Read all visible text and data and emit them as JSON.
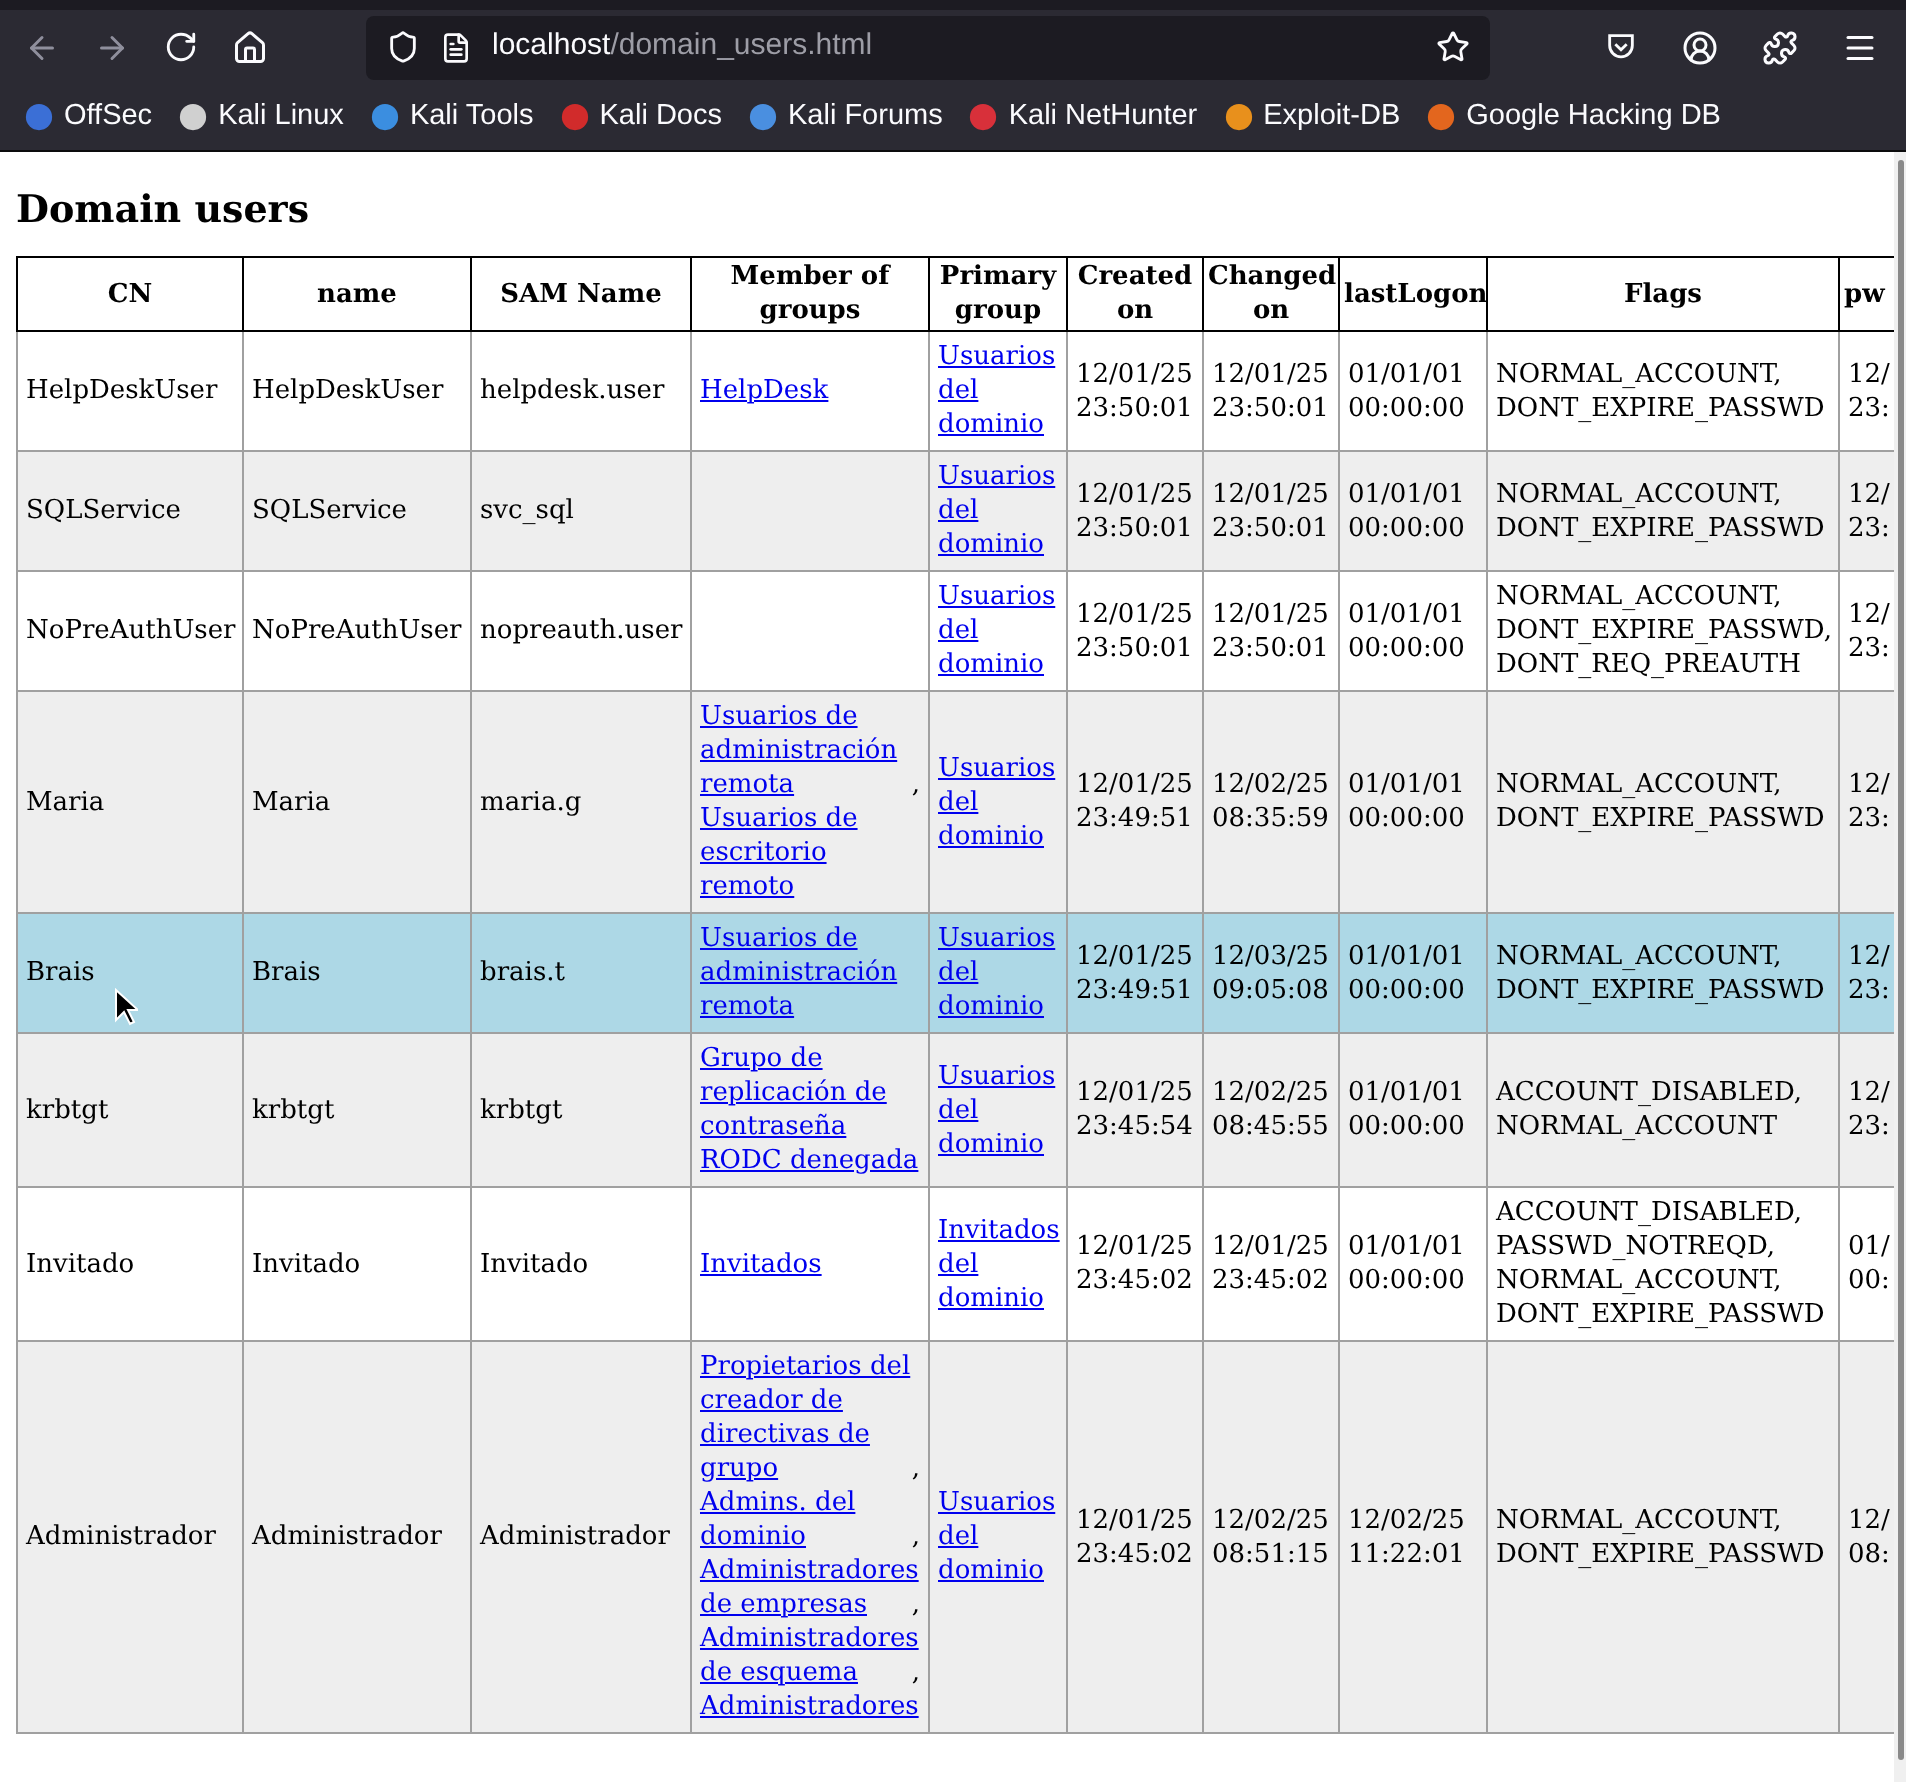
{
  "browser": {
    "url": {
      "host": "localhost",
      "path": "/domain_users.html"
    },
    "bookmarks": [
      {
        "label": "OffSec",
        "color": "#3b6fd6"
      },
      {
        "label": "Kali Linux",
        "color": "#d0d0d0"
      },
      {
        "label": "Kali Tools",
        "color": "#3b8ee0"
      },
      {
        "label": "Kali Docs",
        "color": "#d12b2b"
      },
      {
        "label": "Kali Forums",
        "color": "#4a8fe0"
      },
      {
        "label": "Kali NetHunter",
        "color": "#d8303a"
      },
      {
        "label": "Exploit-DB",
        "color": "#e8901c"
      },
      {
        "label": "Google Hacking DB",
        "color": "#e3661e"
      }
    ]
  },
  "page": {
    "heading": "Domain users",
    "table": {
      "columns": [
        "CN",
        "name",
        "SAM Name",
        "Member of groups",
        "Primary group",
        "Created on",
        "Changed on",
        "lastLogon",
        "Flags",
        "pw"
      ],
      "rows": [
        {
          "selected": false,
          "cn": "HelpDeskUser",
          "name": "HelpDeskUser",
          "sam": "helpdesk.user",
          "member_of": [
            {
              "label": "HelpDesk"
            }
          ],
          "primary_group": "Usuarios del dominio",
          "created": "12/01/25 23:50:01",
          "changed": "12/01/25 23:50:01",
          "last_logon": "01/01/01 00:00:00",
          "flags": "NORMAL_ACCOUNT, DONT_EXPIRE_PASSWD",
          "pwd": "12/ 23:"
        },
        {
          "selected": false,
          "cn": "SQLService",
          "name": "SQLService",
          "sam": "svc_sql",
          "member_of": [],
          "primary_group": "Usuarios del dominio",
          "created": "12/01/25 23:50:01",
          "changed": "12/01/25 23:50:01",
          "last_logon": "01/01/01 00:00:00",
          "flags": "NORMAL_ACCOUNT, DONT_EXPIRE_PASSWD",
          "pwd": "12/ 23:"
        },
        {
          "selected": false,
          "cn": "NoPreAuthUser",
          "name": "NoPreAuthUser",
          "sam": "nopreauth.user",
          "member_of": [],
          "primary_group": "Usuarios del dominio",
          "created": "12/01/25 23:50:01",
          "changed": "12/01/25 23:50:01",
          "last_logon": "01/01/01 00:00:00",
          "flags": "NORMAL_ACCOUNT, DONT_EXPIRE_PASSWD, DONT_REQ_PREAUTH",
          "pwd": "12/ 23:"
        },
        {
          "selected": false,
          "cn": "Maria",
          "name": "Maria",
          "sam": "maria.g",
          "member_of": [
            {
              "label": "Usuarios de administración remota",
              "suffix": ","
            },
            {
              "label": "Usuarios de escritorio remoto"
            }
          ],
          "primary_group": "Usuarios del dominio",
          "created": "12/01/25 23:49:51",
          "changed": "12/02/25 08:35:59",
          "last_logon": "01/01/01 00:00:00",
          "flags": "NORMAL_ACCOUNT, DONT_EXPIRE_PASSWD",
          "pwd": "12/ 23:"
        },
        {
          "selected": true,
          "cn": "Brais",
          "name": "Brais",
          "sam": "brais.t",
          "member_of": [
            {
              "label": "Usuarios de administración remota"
            }
          ],
          "primary_group": "Usuarios del dominio",
          "created": "12/01/25 23:49:51",
          "changed": "12/03/25 09:05:08",
          "last_logon": "01/01/01 00:00:00",
          "flags": "NORMAL_ACCOUNT, DONT_EXPIRE_PASSWD",
          "pwd": "12/ 23:"
        },
        {
          "selected": false,
          "cn": "krbtgt",
          "name": "krbtgt",
          "sam": "krbtgt",
          "member_of": [
            {
              "label": "Grupo de replicación de contraseña RODC denegada"
            }
          ],
          "primary_group": "Usuarios del dominio",
          "created": "12/01/25 23:45:54",
          "changed": "12/02/25 08:45:55",
          "last_logon": "01/01/01 00:00:00",
          "flags": "ACCOUNT_DISABLED, NORMAL_ACCOUNT",
          "pwd": "12/ 23:"
        },
        {
          "selected": false,
          "cn": "Invitado",
          "name": "Invitado",
          "sam": "Invitado",
          "member_of": [
            {
              "label": "Invitados"
            }
          ],
          "primary_group": "Invitados del dominio",
          "created": "12/01/25 23:45:02",
          "changed": "12/01/25 23:45:02",
          "last_logon": "01/01/01 00:00:00",
          "flags": "ACCOUNT_DISABLED, PASSWD_NOTREQD, NORMAL_ACCOUNT, DONT_EXPIRE_PASSWD",
          "pwd": "01/ 00:"
        },
        {
          "selected": false,
          "cn": "Administrador",
          "name": "Administrador",
          "sam": "Administrador",
          "member_of": [
            {
              "label": "Propietarios del creador de directivas de grupo",
              "suffix": ","
            },
            {
              "label": "Admins. del dominio",
              "suffix": ","
            },
            {
              "label": "Administradores de empresas",
              "suffix": ","
            },
            {
              "label": "Administradores de esquema",
              "suffix": ","
            },
            {
              "label": "Administradores"
            }
          ],
          "primary_group": "Usuarios del dominio",
          "created": "12/01/25 23:45:02",
          "changed": "12/02/25 08:51:15",
          "last_logon": "12/02/25 11:22:01",
          "flags": "NORMAL_ACCOUNT, DONT_EXPIRE_PASSWD",
          "pwd": "12/ 08:"
        }
      ]
    }
  }
}
